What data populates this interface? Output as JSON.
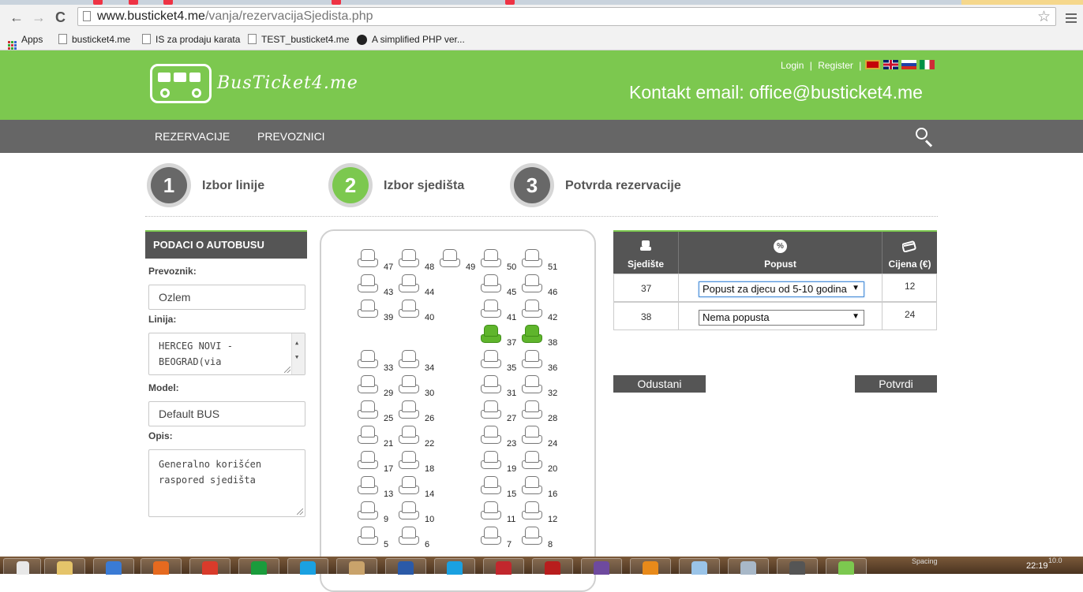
{
  "browser": {
    "url_host": "www.busticket4.me",
    "url_path": "/vanja/rezervacijaSjedista.php",
    "bookmarks": [
      "Apps",
      "busticket4.me",
      "IS za prodaju karata",
      "TEST_busticket4.me",
      "A simplified PHP ver..."
    ]
  },
  "header": {
    "logo_text": "BusTicket4.me",
    "login": "Login",
    "separator": "|",
    "register": "Register",
    "contact": "Kontakt email: office@busticket4.me"
  },
  "nav": {
    "items": [
      "REZERVACIJE",
      "PREVOZNICI"
    ]
  },
  "steps": [
    {
      "num": "1",
      "label": "Izbor linije",
      "active": false
    },
    {
      "num": "2",
      "label": "Izbor sjedišta",
      "active": true
    },
    {
      "num": "3",
      "label": "Potvrda rezervacije",
      "active": false
    }
  ],
  "bus_info": {
    "title": "PODACI O AUTOBUSU",
    "carrier_label": "Prevoznik:",
    "carrier_value": "Ozlem",
    "line_label": "Linija:",
    "line_value_1": "HERCEG NOVI -",
    "line_value_2": "BEOGRAD(via",
    "model_label": "Model:",
    "model_value": "Default BUS",
    "desc_label": "Opis:",
    "desc_value_1": "Generalno korišćen",
    "desc_value_2": "raspored sjedišta"
  },
  "seats": {
    "selected": [
      "37",
      "38"
    ],
    "rows": [
      [
        "47",
        "48",
        "49",
        "50",
        "51"
      ],
      [
        "43",
        "44",
        "",
        "45",
        "46"
      ],
      [
        "39",
        "40",
        "",
        "41",
        "42"
      ],
      [
        "",
        "",
        "",
        "37",
        "38"
      ],
      [
        "33",
        "34",
        "",
        "35",
        "36"
      ],
      [
        "29",
        "30",
        "",
        "31",
        "32"
      ],
      [
        "25",
        "26",
        "",
        "27",
        "28"
      ],
      [
        "21",
        "22",
        "",
        "23",
        "24"
      ],
      [
        "17",
        "18",
        "",
        "19",
        "20"
      ],
      [
        "13",
        "14",
        "",
        "15",
        "16"
      ],
      [
        "9",
        "10",
        "",
        "11",
        "12"
      ],
      [
        "5",
        "6",
        "",
        "7",
        "8"
      ]
    ]
  },
  "reservation": {
    "headers": {
      "seat": "Sjedište",
      "discount": "Popust",
      "discount_icon": "%",
      "price": "Cijena (€)"
    },
    "rows": [
      {
        "seat": "37",
        "discount": "Popust za djecu od 5-10 godina",
        "price": "12"
      },
      {
        "seat": "38",
        "discount": "Nema popusta",
        "price": "24"
      }
    ],
    "cancel": "Odustani",
    "confirm": "Potvrdi"
  },
  "taskbar": {
    "spacing": "Spacing",
    "version": "10.0",
    "time": "22:19"
  },
  "colors": {
    "brand_green": "#7cc84f",
    "dark_gray": "#555555",
    "nav_gray": "#666666"
  }
}
